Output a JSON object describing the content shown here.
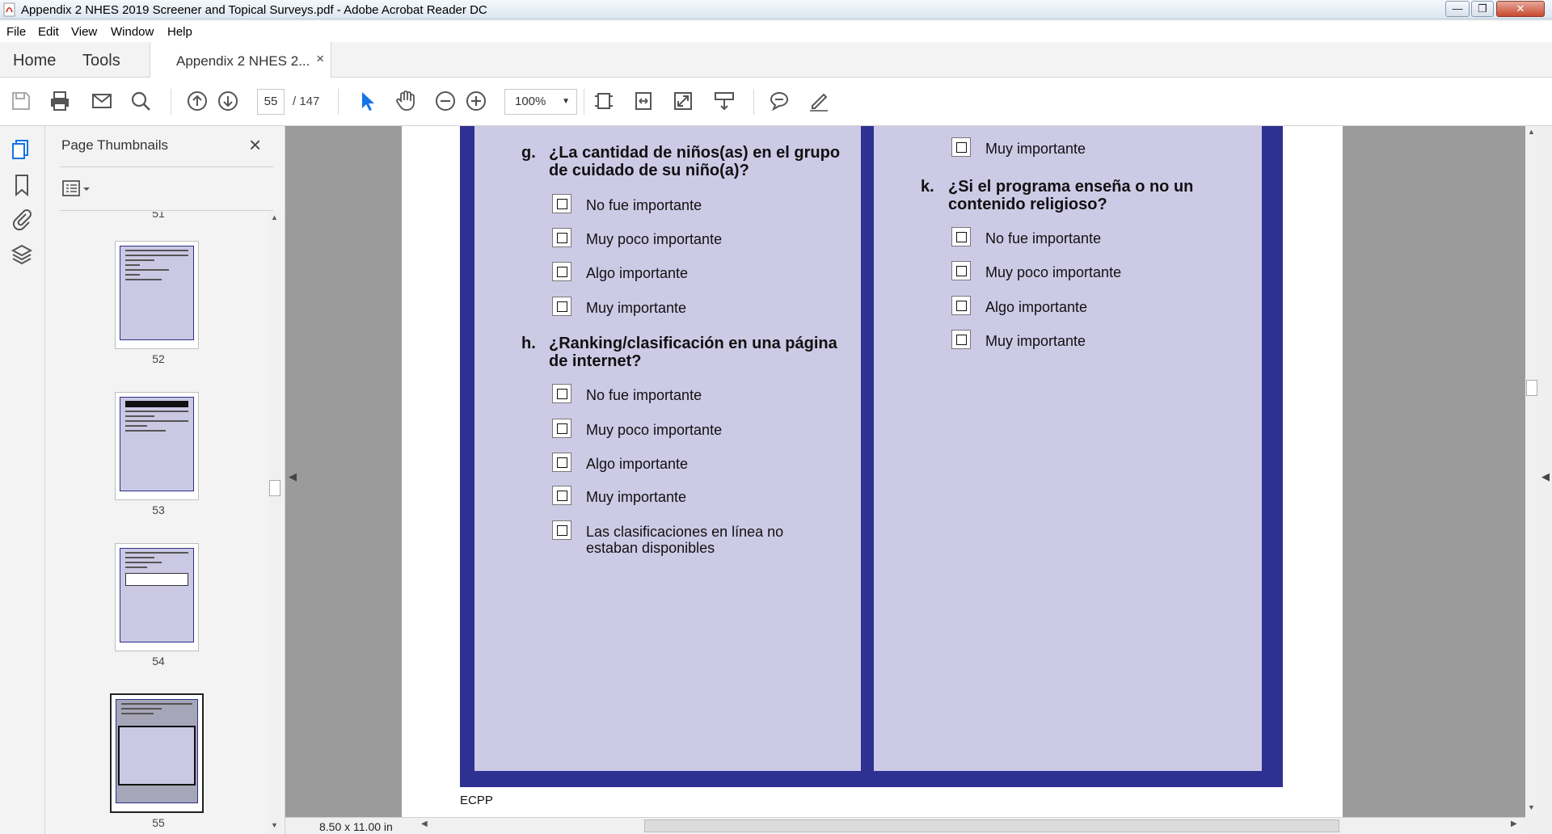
{
  "window": {
    "title": "Appendix 2 NHES 2019 Screener and Topical Surveys.pdf - Adobe Acrobat Reader DC",
    "minimize": "—",
    "maximize": "❐",
    "close": "✕"
  },
  "menu": [
    "File",
    "Edit",
    "View",
    "Window",
    "Help"
  ],
  "tabs": {
    "home": "Home",
    "tools": "Tools",
    "document": "Appendix 2 NHES 2...",
    "close": "×"
  },
  "toolbar": {
    "page_current": "55",
    "page_total": "/ 147",
    "zoom": "100%"
  },
  "thumbnails": {
    "title": "Page Thumbnails",
    "close": "×",
    "partial_label": "51",
    "pages": [
      "52",
      "53",
      "54",
      "55"
    ],
    "current": "55"
  },
  "document": {
    "questions_left": [
      {
        "letter": "g.",
        "text": "¿La cantidad de niños(as) en el grupo de cuidado de su niño(a)?",
        "options": [
          "No fue importante",
          "Muy poco importante",
          "Algo importante",
          "Muy importante"
        ]
      },
      {
        "letter": "h.",
        "text": "¿Ranking/clasificación en una página de internet?",
        "options": [
          "No fue importante",
          "Muy poco importante",
          "Algo importante",
          "Muy importante",
          "Las clasificaciones en línea no estaban disponibles"
        ]
      }
    ],
    "right_top_option": "Muy importante",
    "questions_right": [
      {
        "letter": "k.",
        "text": "¿Si el programa enseña o no un contenido religioso?",
        "options": [
          "No fue importante",
          "Muy poco importante",
          "Algo importante",
          "Muy importante"
        ]
      }
    ],
    "footer": "ECPP"
  },
  "status": {
    "page_size": "8.50 x 11.00 in"
  },
  "colors": {
    "frame": "#2e3192",
    "column_bg": "#cdcae6",
    "accent": "#1473e6"
  }
}
